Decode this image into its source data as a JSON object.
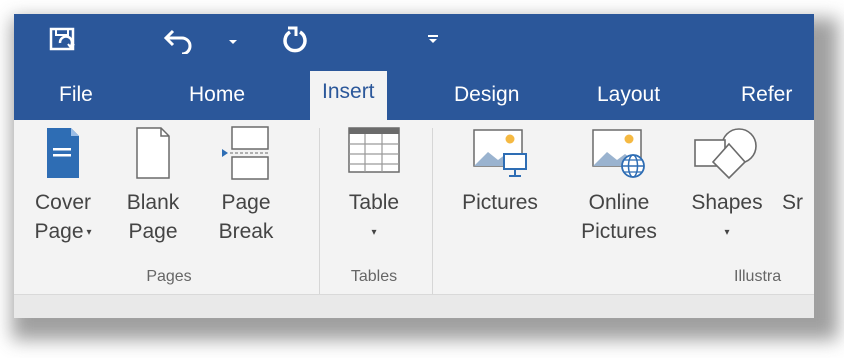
{
  "qat": {
    "items": [
      {
        "icon": "save-icon"
      },
      {
        "icon": "undo-icon"
      },
      {
        "icon": "undo-dropdown-icon"
      },
      {
        "icon": "redo-icon"
      },
      {
        "icon": "customize-toolbar-icon"
      }
    ]
  },
  "tabs": {
    "file": "File",
    "home": "Home",
    "insert": "Insert",
    "design": "Design",
    "layout": "Layout",
    "references": "Refer"
  },
  "groups": {
    "pages": {
      "label": "Pages",
      "cover_page": {
        "line1": "Cover",
        "line2": "Page"
      },
      "blank_page": {
        "line1": "Blank",
        "line2": "Page"
      },
      "page_break": {
        "line1": "Page",
        "line2": "Break"
      }
    },
    "tables": {
      "label": "Tables",
      "table": {
        "line1": "Table"
      }
    },
    "illustrations": {
      "label": "Illustra",
      "pictures": {
        "line1": "Pictures"
      },
      "online_pictures": {
        "line1": "Online",
        "line2": "Pictures"
      },
      "shapes": {
        "line1": "Shapes"
      },
      "smartart": {
        "line1": "Sr"
      }
    }
  },
  "colors": {
    "ribbon_blue": "#2b579a",
    "ribbon_body": "#f3f3f3",
    "icon_blue": "#2e6db4"
  }
}
